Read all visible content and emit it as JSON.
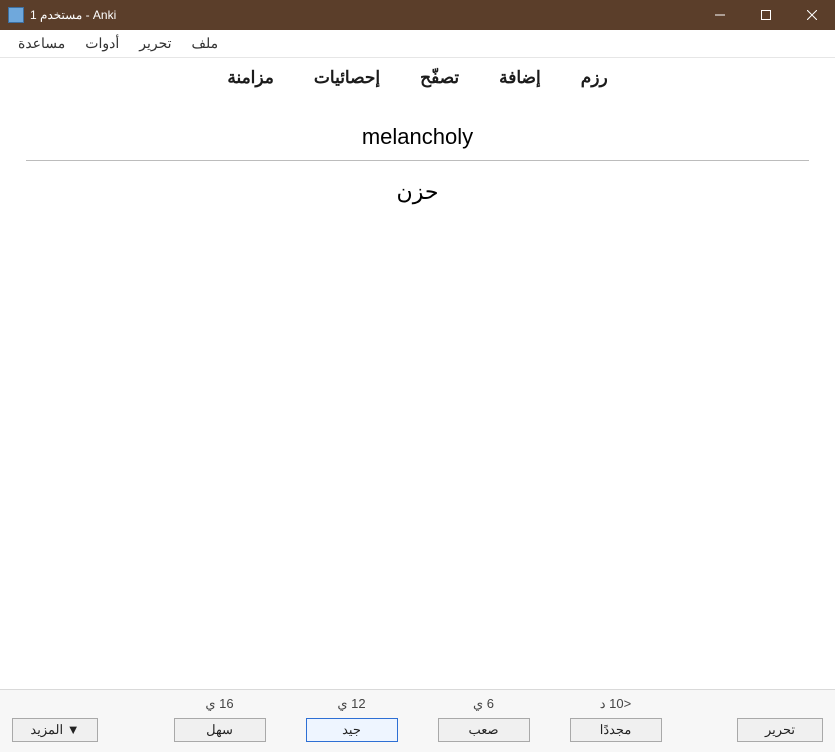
{
  "window": {
    "title": "مستخدم 1 - Anki"
  },
  "menu": {
    "file": "ملف",
    "edit": "تحرير",
    "tools": "أدوات",
    "help": "مساعدة"
  },
  "nav": {
    "decks": "رزم",
    "add": "إضافة",
    "browse": "تصفّح",
    "stats": "إحصائيات",
    "sync": "مزامنة"
  },
  "card": {
    "front": "melancholy",
    "back": "حزن"
  },
  "ease": {
    "again": {
      "time": "<10 د",
      "label": "مجددًا"
    },
    "hard": {
      "time": "6 ي",
      "label": "صعب"
    },
    "good": {
      "time": "12 ي",
      "label": "جيد"
    },
    "easy": {
      "time": "16 ي",
      "label": "سهل"
    }
  },
  "footer": {
    "edit": "تحرير",
    "more": "المزيد ▼"
  }
}
